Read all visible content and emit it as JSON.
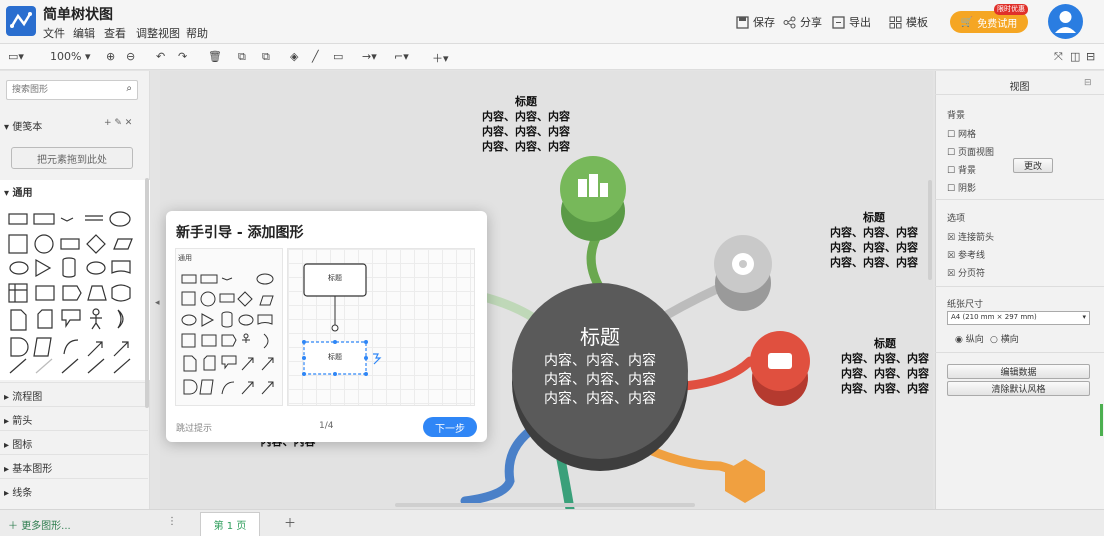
{
  "app": {
    "title": "简单树状图",
    "menu": [
      "文件",
      "编辑",
      "查看",
      "调整视图",
      "帮助"
    ],
    "actions": [
      "保存",
      "分享",
      "导出",
      "模板"
    ],
    "upgrade_label": "免费试用",
    "upgrade_badge": "限时优惠"
  },
  "toolbar": {
    "zoom": "100%"
  },
  "left_panel": {
    "search_placeholder": "搜索图形",
    "scratchpad_label": "便笺本",
    "add_shapes_label": "把元素拖到此处",
    "general_label": "通用",
    "categories": [
      "流程图",
      "箭头",
      "图标",
      "基本图形",
      "线条"
    ],
    "more_shapes": "更多图形..."
  },
  "bottom": {
    "page_tab": "第 1 页"
  },
  "canvas": {
    "center_title": "标题",
    "center_content": [
      "内容、内容、内容",
      "内容、内容、内容",
      "内容、内容、内容"
    ],
    "topic_title": "标题",
    "topic_content": [
      "内容、内容、内容",
      "内容、内容、内容",
      "内容、内容、内容"
    ],
    "bottom_fragment": "内容、内容"
  },
  "right_panel": {
    "header": "视图",
    "section1": "背景",
    "opt_grid": "网格",
    "opt_page_view": "页面视图",
    "opt_background": "背景",
    "opt_shadow": "阴影",
    "change_label": "更改",
    "section2": "选项",
    "opt_connect_arrows": "连接箭头",
    "opt_guides": "参考线",
    "opt_page_break": "分页符",
    "paper_size_label": "纸张尺寸",
    "paper_size_value": "A4 (210 mm × 297 mm)",
    "portrait": "纵向",
    "landscape": "横向",
    "btn_edit_data": "编辑数据",
    "btn_clear_style": "清除默认风格"
  },
  "guide_popup": {
    "title": "新手引导 - 添加图形",
    "mini_label": "通用",
    "shape_label_1": "标题",
    "shape_label_2": "标题",
    "skip_label": "跳过提示",
    "step": "1/4",
    "next_label": "下一步"
  },
  "colors": {
    "accent_blue": "#2f86f6",
    "center_gray": "#555555",
    "green": "#6aa84f",
    "red": "#e05040",
    "orange": "#f0a040",
    "blue_branch": "#4a80c8"
  }
}
